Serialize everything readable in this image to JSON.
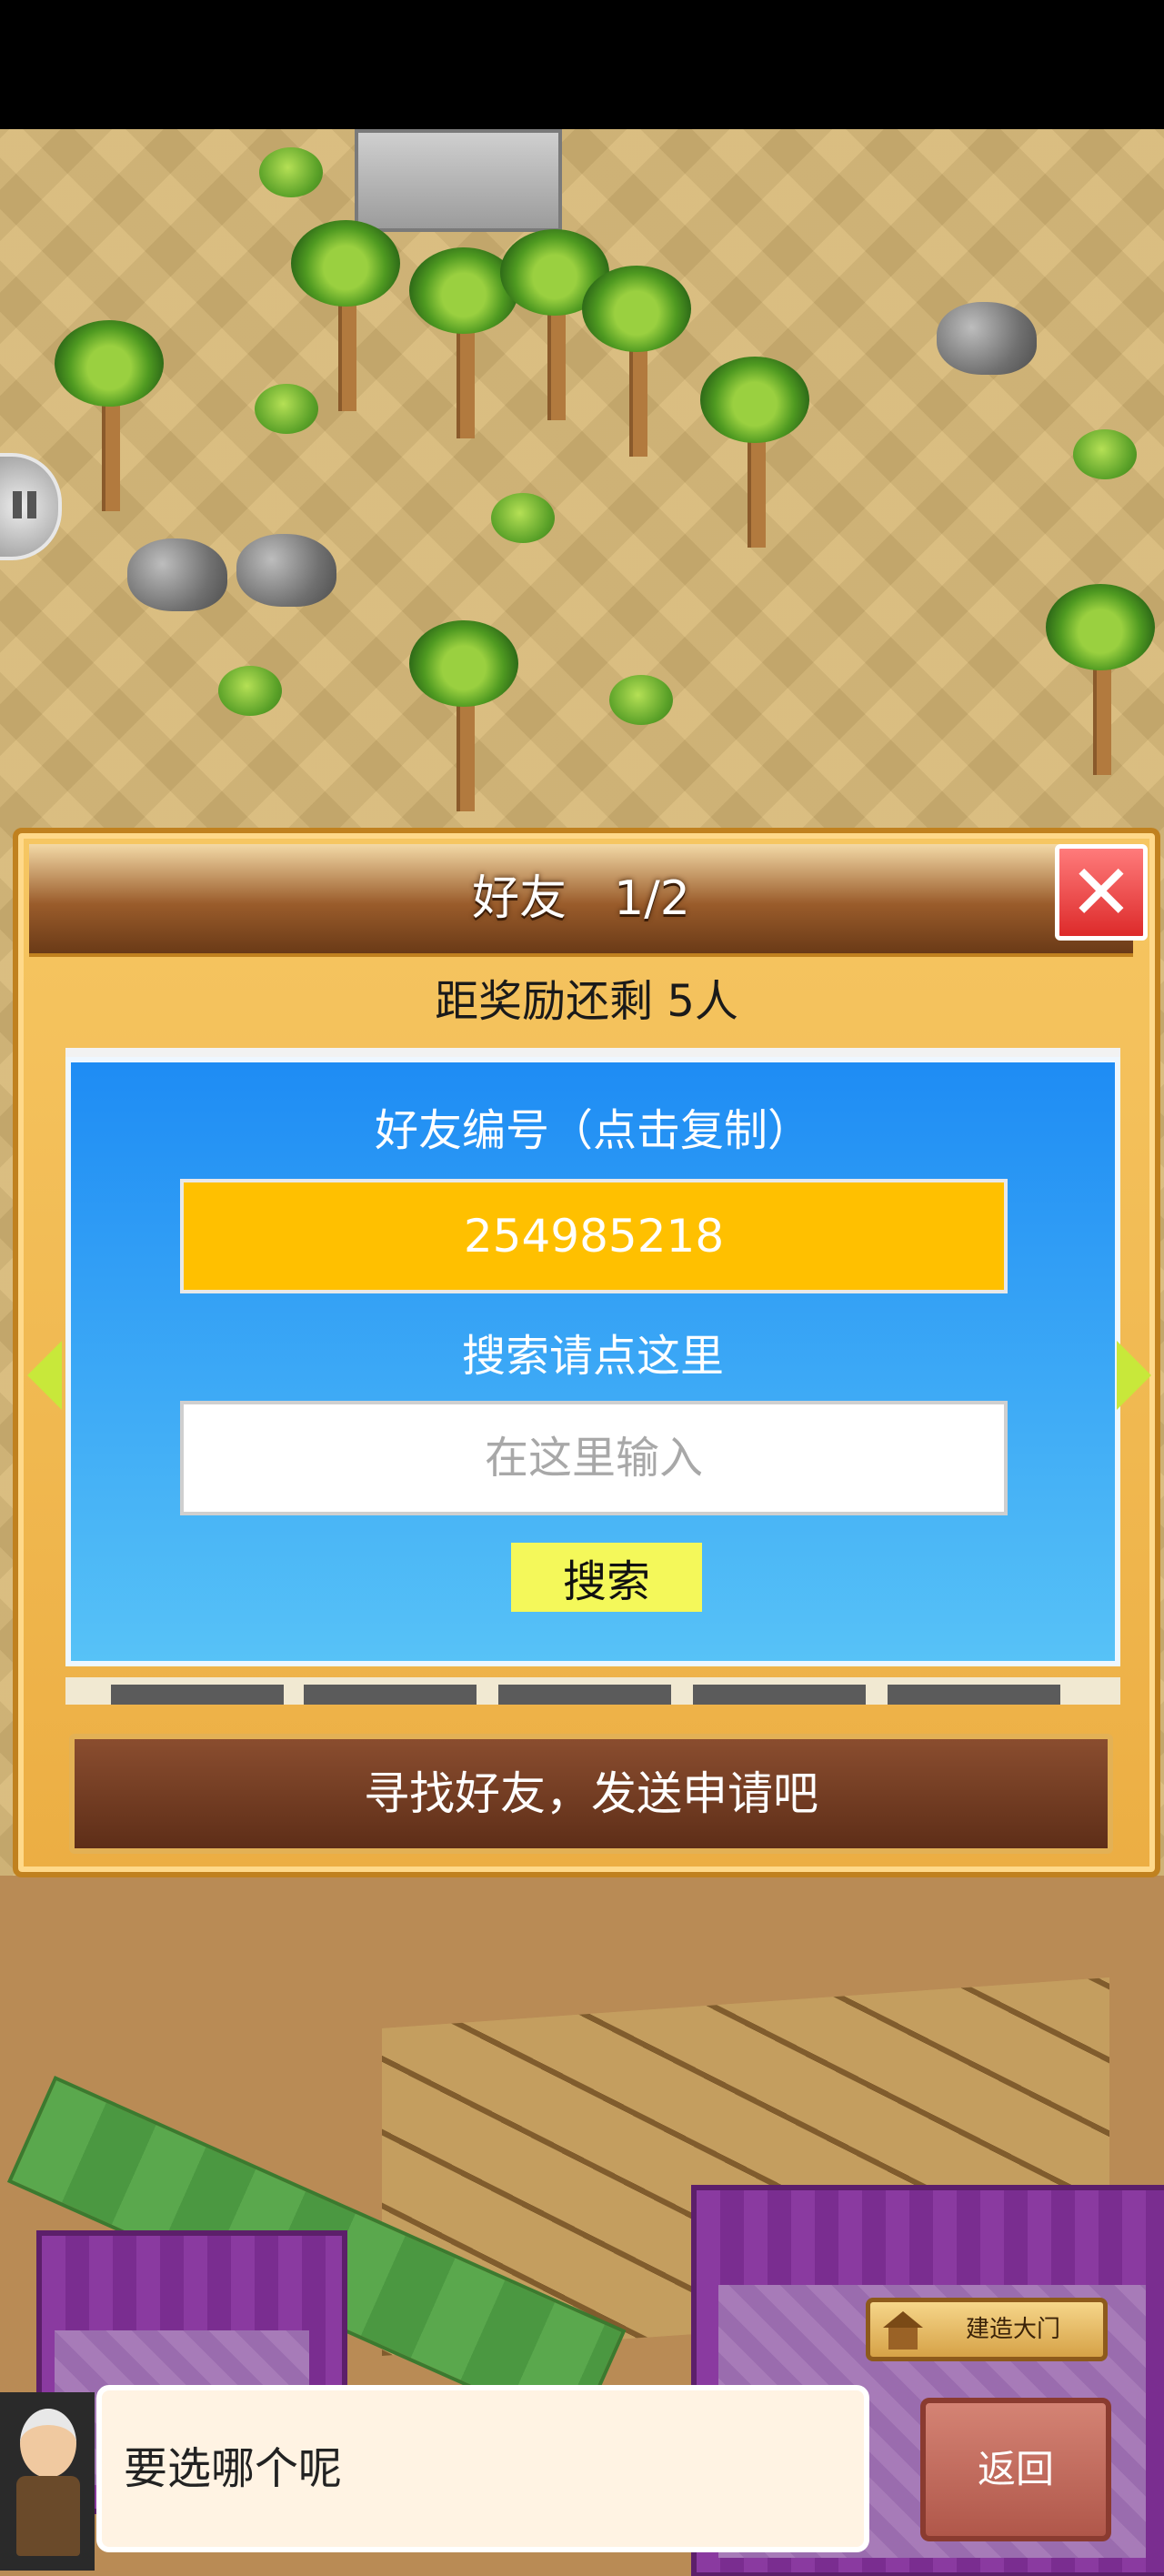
{
  "dialog": {
    "title": "好友　1/2",
    "close_icon": "close-x-icon",
    "reward_progress": "距奖励还剩 5人",
    "friend_id_label": "好友编号（点击复制）",
    "friend_id_value": "254985218",
    "search_label": "搜索请点这里",
    "search_placeholder": "在这里输入",
    "search_value": "",
    "search_button": "搜索",
    "find_friends_button": "寻找好友，发送申请吧",
    "page_current": 1,
    "page_total": 2
  },
  "hud": {
    "build_gate_label": "建造大门",
    "dialogue_text": "要选哪个呢",
    "return_button": "返回"
  },
  "colors": {
    "panel_blue_top": "#1e8cf4",
    "panel_blue_bottom": "#57c2f7",
    "id_box": "#ffc000",
    "search_button": "#f4f85a",
    "close_red": "#dd2a2a",
    "dialog_orange": "#f6c662",
    "find_button_brown": "#5e2e18"
  }
}
